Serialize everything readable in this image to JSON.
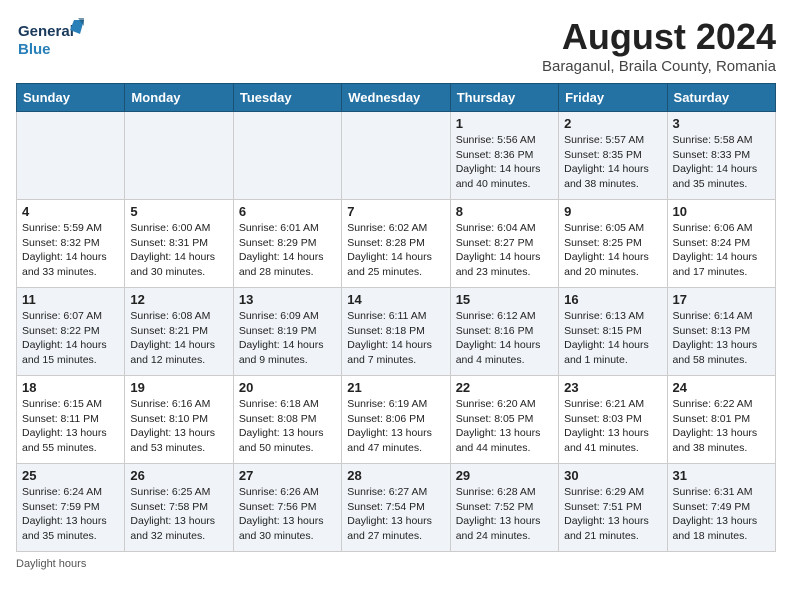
{
  "header": {
    "logo_line1": "General",
    "logo_line2": "Blue",
    "month_year": "August 2024",
    "location": "Baraganul, Braila County, Romania"
  },
  "days_of_week": [
    "Sunday",
    "Monday",
    "Tuesday",
    "Wednesday",
    "Thursday",
    "Friday",
    "Saturday"
  ],
  "weeks": [
    [
      {
        "day": "",
        "info": ""
      },
      {
        "day": "",
        "info": ""
      },
      {
        "day": "",
        "info": ""
      },
      {
        "day": "",
        "info": ""
      },
      {
        "day": "1",
        "info": "Sunrise: 5:56 AM\nSunset: 8:36 PM\nDaylight: 14 hours\nand 40 minutes."
      },
      {
        "day": "2",
        "info": "Sunrise: 5:57 AM\nSunset: 8:35 PM\nDaylight: 14 hours\nand 38 minutes."
      },
      {
        "day": "3",
        "info": "Sunrise: 5:58 AM\nSunset: 8:33 PM\nDaylight: 14 hours\nand 35 minutes."
      }
    ],
    [
      {
        "day": "4",
        "info": "Sunrise: 5:59 AM\nSunset: 8:32 PM\nDaylight: 14 hours\nand 33 minutes."
      },
      {
        "day": "5",
        "info": "Sunrise: 6:00 AM\nSunset: 8:31 PM\nDaylight: 14 hours\nand 30 minutes."
      },
      {
        "day": "6",
        "info": "Sunrise: 6:01 AM\nSunset: 8:29 PM\nDaylight: 14 hours\nand 28 minutes."
      },
      {
        "day": "7",
        "info": "Sunrise: 6:02 AM\nSunset: 8:28 PM\nDaylight: 14 hours\nand 25 minutes."
      },
      {
        "day": "8",
        "info": "Sunrise: 6:04 AM\nSunset: 8:27 PM\nDaylight: 14 hours\nand 23 minutes."
      },
      {
        "day": "9",
        "info": "Sunrise: 6:05 AM\nSunset: 8:25 PM\nDaylight: 14 hours\nand 20 minutes."
      },
      {
        "day": "10",
        "info": "Sunrise: 6:06 AM\nSunset: 8:24 PM\nDaylight: 14 hours\nand 17 minutes."
      }
    ],
    [
      {
        "day": "11",
        "info": "Sunrise: 6:07 AM\nSunset: 8:22 PM\nDaylight: 14 hours\nand 15 minutes."
      },
      {
        "day": "12",
        "info": "Sunrise: 6:08 AM\nSunset: 8:21 PM\nDaylight: 14 hours\nand 12 minutes."
      },
      {
        "day": "13",
        "info": "Sunrise: 6:09 AM\nSunset: 8:19 PM\nDaylight: 14 hours\nand 9 minutes."
      },
      {
        "day": "14",
        "info": "Sunrise: 6:11 AM\nSunset: 8:18 PM\nDaylight: 14 hours\nand 7 minutes."
      },
      {
        "day": "15",
        "info": "Sunrise: 6:12 AM\nSunset: 8:16 PM\nDaylight: 14 hours\nand 4 minutes."
      },
      {
        "day": "16",
        "info": "Sunrise: 6:13 AM\nSunset: 8:15 PM\nDaylight: 14 hours\nand 1 minute."
      },
      {
        "day": "17",
        "info": "Sunrise: 6:14 AM\nSunset: 8:13 PM\nDaylight: 13 hours\nand 58 minutes."
      }
    ],
    [
      {
        "day": "18",
        "info": "Sunrise: 6:15 AM\nSunset: 8:11 PM\nDaylight: 13 hours\nand 55 minutes."
      },
      {
        "day": "19",
        "info": "Sunrise: 6:16 AM\nSunset: 8:10 PM\nDaylight: 13 hours\nand 53 minutes."
      },
      {
        "day": "20",
        "info": "Sunrise: 6:18 AM\nSunset: 8:08 PM\nDaylight: 13 hours\nand 50 minutes."
      },
      {
        "day": "21",
        "info": "Sunrise: 6:19 AM\nSunset: 8:06 PM\nDaylight: 13 hours\nand 47 minutes."
      },
      {
        "day": "22",
        "info": "Sunrise: 6:20 AM\nSunset: 8:05 PM\nDaylight: 13 hours\nand 44 minutes."
      },
      {
        "day": "23",
        "info": "Sunrise: 6:21 AM\nSunset: 8:03 PM\nDaylight: 13 hours\nand 41 minutes."
      },
      {
        "day": "24",
        "info": "Sunrise: 6:22 AM\nSunset: 8:01 PM\nDaylight: 13 hours\nand 38 minutes."
      }
    ],
    [
      {
        "day": "25",
        "info": "Sunrise: 6:24 AM\nSunset: 7:59 PM\nDaylight: 13 hours\nand 35 minutes."
      },
      {
        "day": "26",
        "info": "Sunrise: 6:25 AM\nSunset: 7:58 PM\nDaylight: 13 hours\nand 32 minutes."
      },
      {
        "day": "27",
        "info": "Sunrise: 6:26 AM\nSunset: 7:56 PM\nDaylight: 13 hours\nand 30 minutes."
      },
      {
        "day": "28",
        "info": "Sunrise: 6:27 AM\nSunset: 7:54 PM\nDaylight: 13 hours\nand 27 minutes."
      },
      {
        "day": "29",
        "info": "Sunrise: 6:28 AM\nSunset: 7:52 PM\nDaylight: 13 hours\nand 24 minutes."
      },
      {
        "day": "30",
        "info": "Sunrise: 6:29 AM\nSunset: 7:51 PM\nDaylight: 13 hours\nand 21 minutes."
      },
      {
        "day": "31",
        "info": "Sunrise: 6:31 AM\nSunset: 7:49 PM\nDaylight: 13 hours\nand 18 minutes."
      }
    ]
  ],
  "footer": {
    "note": "Daylight hours"
  }
}
